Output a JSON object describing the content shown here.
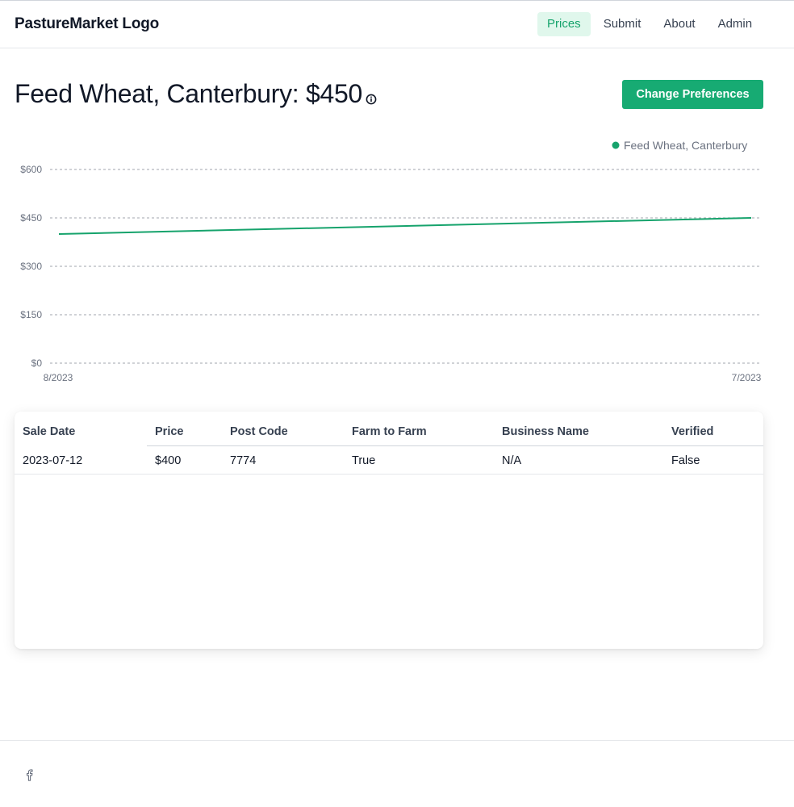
{
  "header": {
    "logo": "PastureMarket Logo",
    "nav": [
      {
        "label": "Prices",
        "active": true
      },
      {
        "label": "Submit",
        "active": false
      },
      {
        "label": "About",
        "active": false
      },
      {
        "label": "Admin",
        "active": false
      }
    ]
  },
  "main": {
    "title": "Feed Wheat, Canterbury: $450",
    "info_icon": "info-icon",
    "change_preferences_label": "Change Preferences"
  },
  "colors": {
    "accent": "#17ab73",
    "nav_active_bg": "#e0f7ec",
    "series": "#16a36c"
  },
  "chart_data": {
    "type": "line",
    "title": "",
    "xlabel": "",
    "ylabel": "",
    "x_ticks": [
      "8/2023",
      "7/2023"
    ],
    "y_ticks": [
      "$0",
      "$150",
      "$300",
      "$450",
      "$600"
    ],
    "ylim": [
      0,
      600
    ],
    "grid": true,
    "legend_position": "top-right",
    "series": [
      {
        "name": "Feed Wheat, Canterbury",
        "color": "#16a36c",
        "x": [
          "8/2023",
          "7/2023"
        ],
        "values": [
          400,
          450
        ]
      }
    ]
  },
  "table": {
    "columns": [
      "Sale Date",
      "Price",
      "Post Code",
      "Farm to Farm",
      "Business Name",
      "Verified"
    ],
    "rows": [
      [
        "2023-07-12",
        "$400",
        "7774",
        "True",
        "N/A",
        "False"
      ]
    ]
  },
  "footer": {
    "icons": [
      "facebook-icon"
    ]
  }
}
